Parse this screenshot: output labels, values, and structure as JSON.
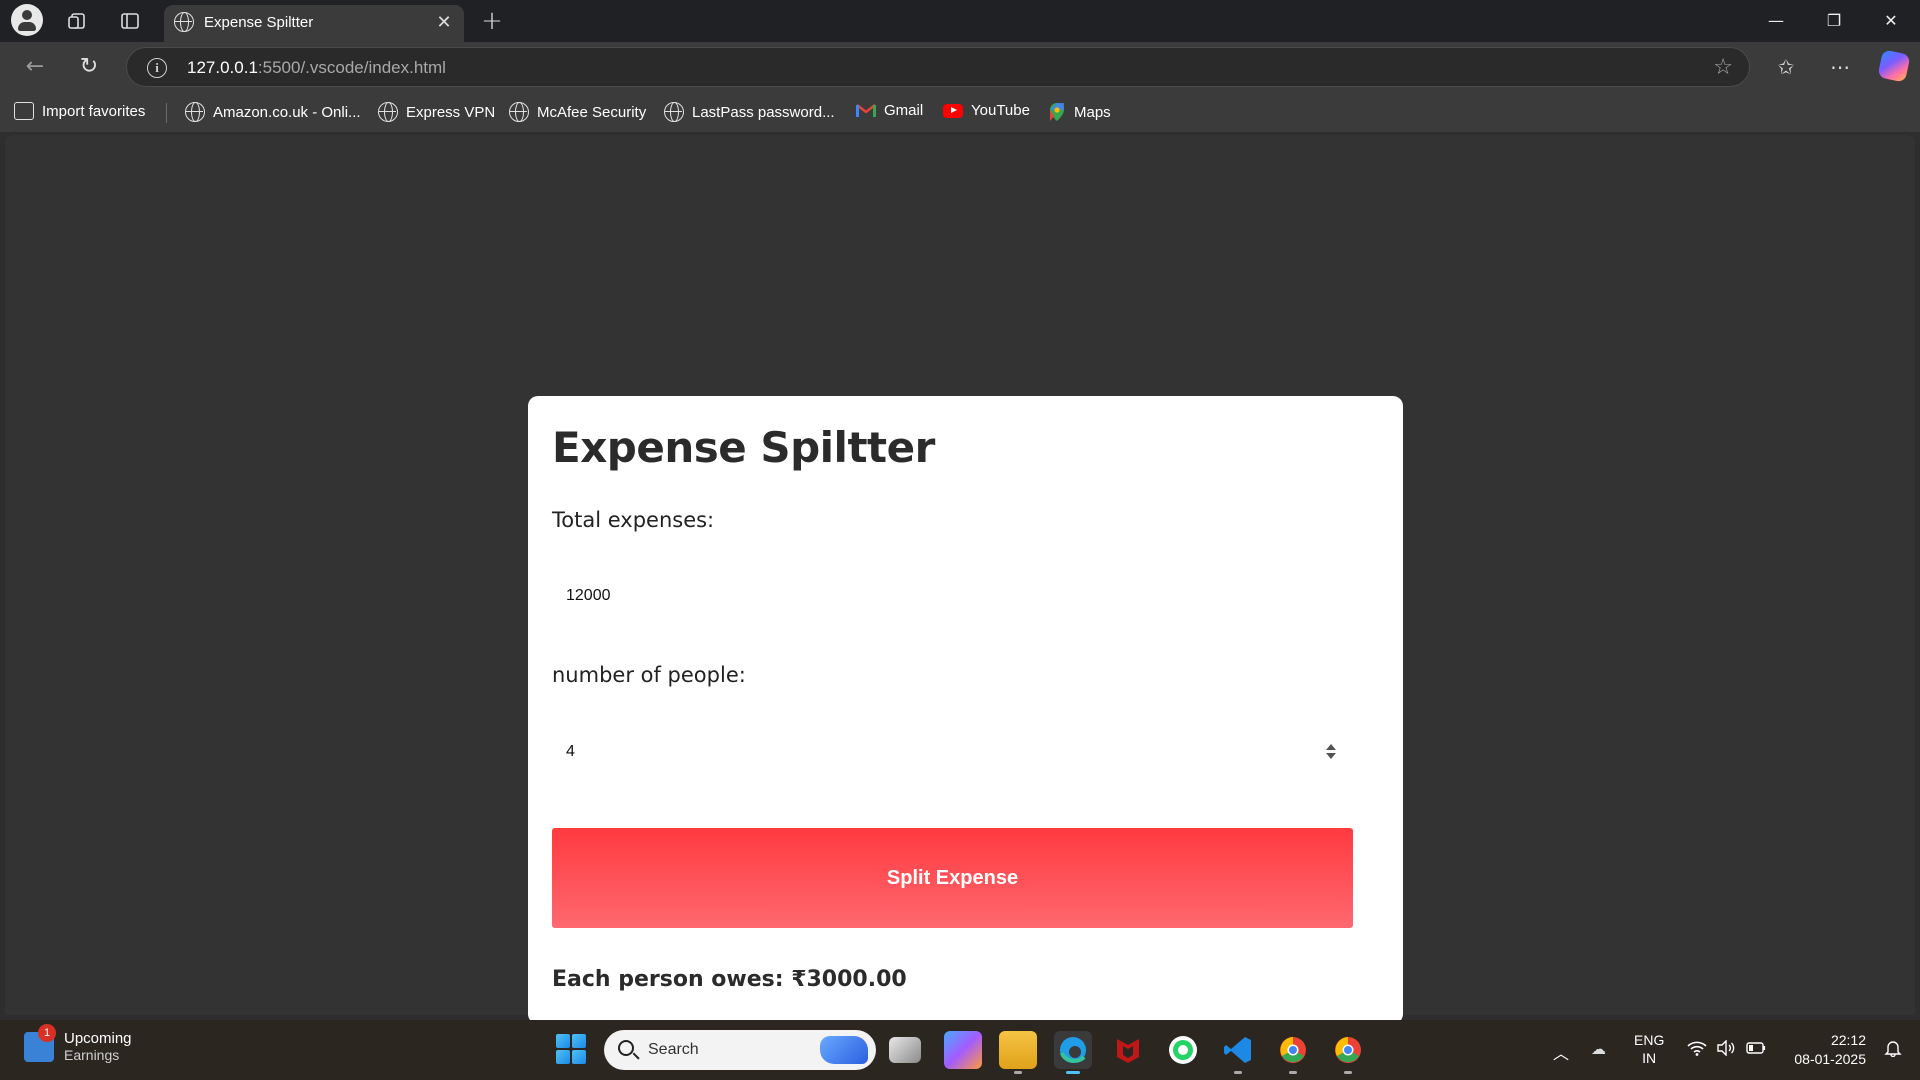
{
  "browser": {
    "tab_title": "Expense Spiltter",
    "url_host": "127.0.0.1",
    "url_rest": ":5500/.vscode/index.html"
  },
  "favorites": [
    {
      "label": "Import favorites",
      "icon": "import-icon"
    },
    {
      "label": "Amazon.co.uk - Onli...",
      "icon": "globe-icon"
    },
    {
      "label": "Express VPN",
      "icon": "globe-icon"
    },
    {
      "label": "McAfee Security",
      "icon": "globe-icon"
    },
    {
      "label": "LastPass password...",
      "icon": "globe-icon"
    },
    {
      "label": "Gmail",
      "icon": "gmail-icon"
    },
    {
      "label": "YouTube",
      "icon": "youtube-icon"
    },
    {
      "label": "Maps",
      "icon": "maps-icon"
    }
  ],
  "app": {
    "title": "Expense Spiltter",
    "total_label": "Total expenses:",
    "total_value": "12000",
    "people_label": "number of people:",
    "people_value": "4",
    "button_label": "Split Expense",
    "result": "Each person owes: ₹3000.00",
    "accent": "#ff3a3f"
  },
  "taskbar": {
    "widget_badge": "1",
    "widget_title": "Upcoming",
    "widget_subtitle": "Earnings",
    "search_placeholder": "Search",
    "lang_top": "ENG",
    "lang_bottom": "IN",
    "time": "22:12",
    "date": "08-01-2025"
  }
}
